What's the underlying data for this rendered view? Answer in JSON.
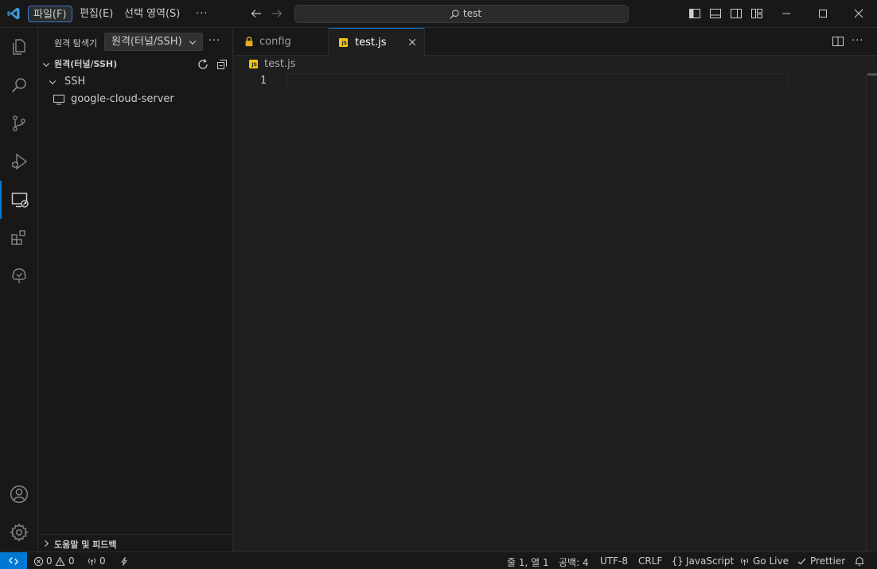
{
  "titlebar": {
    "menus": [
      "파일(F)",
      "편집(E)",
      "선택 영역(S)"
    ],
    "more": "···",
    "search_text": "test"
  },
  "sidebar": {
    "title": "원격 탐색기",
    "select_value": "원격(터널/SSH)",
    "more": "···",
    "section_title": "원격(터널/SSH)",
    "group_label": "SSH",
    "server_label": "google-cloud-server",
    "help_label": "도움말 및 피드백"
  },
  "editor": {
    "tabs": [
      {
        "label": "config",
        "icon": "lock-icon"
      },
      {
        "label": "test.js",
        "icon": "js-file-icon"
      }
    ],
    "js_badge": "JS",
    "breadcrumb": "test.js",
    "line_number": "1"
  },
  "statusbar": {
    "errors": "0",
    "warnings": "0",
    "ports": "0",
    "cursor": "줄 1, 열 1",
    "spaces": "공백: 4",
    "encoding": "UTF-8",
    "eol": "CRLF",
    "language": "JavaScript",
    "golive": "Go Live",
    "prettier": "Prettier"
  },
  "colors": {
    "accent": "#0078d4",
    "background": "#1f1f1f",
    "sidebar": "#181818",
    "js_yellow": "#f1c40f"
  }
}
